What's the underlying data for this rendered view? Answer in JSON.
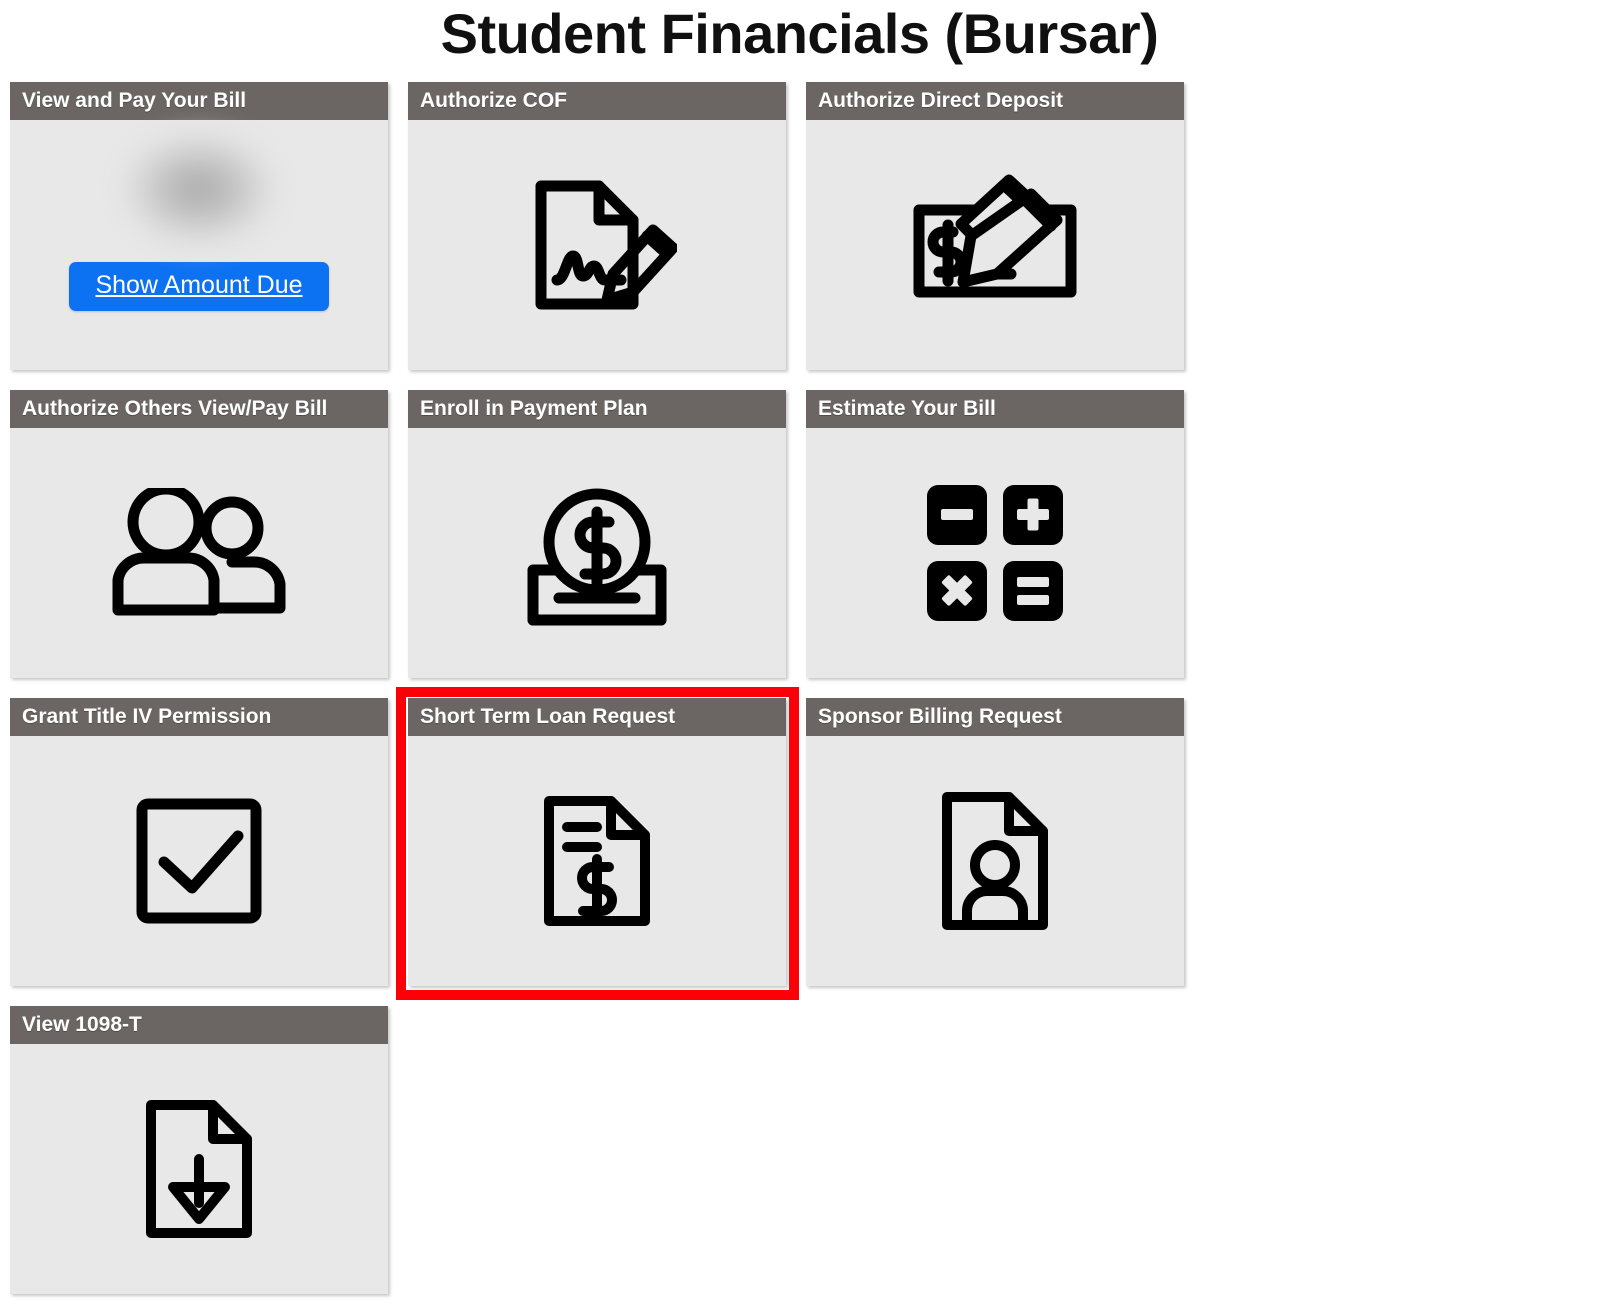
{
  "page": {
    "title": "Student Financials (Bursar)",
    "background_color": "#ffffff",
    "header_color": "#6b6663",
    "card_body_color": "#e8e8e8",
    "accent_color": "#0d72f2",
    "highlight_color": "#fb0007"
  },
  "tiles": [
    {
      "id": "view-and-pay-your-bill",
      "label": "View and Pay Your Bill",
      "icon": "blurred-redacted-icon",
      "button_label": "Show Amount Due",
      "highlighted": false
    },
    {
      "id": "authorize-cof",
      "label": "Authorize COF",
      "icon": "document-signature-pencil-icon",
      "highlighted": false
    },
    {
      "id": "authorize-direct-deposit",
      "label": "Authorize Direct Deposit",
      "icon": "check-with-pencil-icon",
      "highlighted": false
    },
    {
      "id": "authorize-others-view-pay-bill",
      "label": "Authorize Others View/Pay Bill",
      "icon": "two-people-icon",
      "highlighted": false
    },
    {
      "id": "enroll-in-payment-plan",
      "label": "Enroll in Payment Plan",
      "icon": "dollar-coin-deposit-icon",
      "highlighted": false
    },
    {
      "id": "estimate-your-bill",
      "label": "Estimate Your Bill",
      "icon": "calculator-keys-icon",
      "highlighted": false
    },
    {
      "id": "grant-title-iv-permission",
      "label": "Grant Title IV Permission",
      "icon": "checkbox-checked-icon",
      "highlighted": false
    },
    {
      "id": "short-term-loan-request",
      "label": "Short Term Loan Request",
      "icon": "document-dollar-icon",
      "highlighted": true
    },
    {
      "id": "sponsor-billing-request",
      "label": "Sponsor Billing Request",
      "icon": "document-person-icon",
      "highlighted": false
    },
    {
      "id": "view-1098-t",
      "label": "View 1098-T",
      "icon": "document-download-icon",
      "highlighted": false
    }
  ]
}
